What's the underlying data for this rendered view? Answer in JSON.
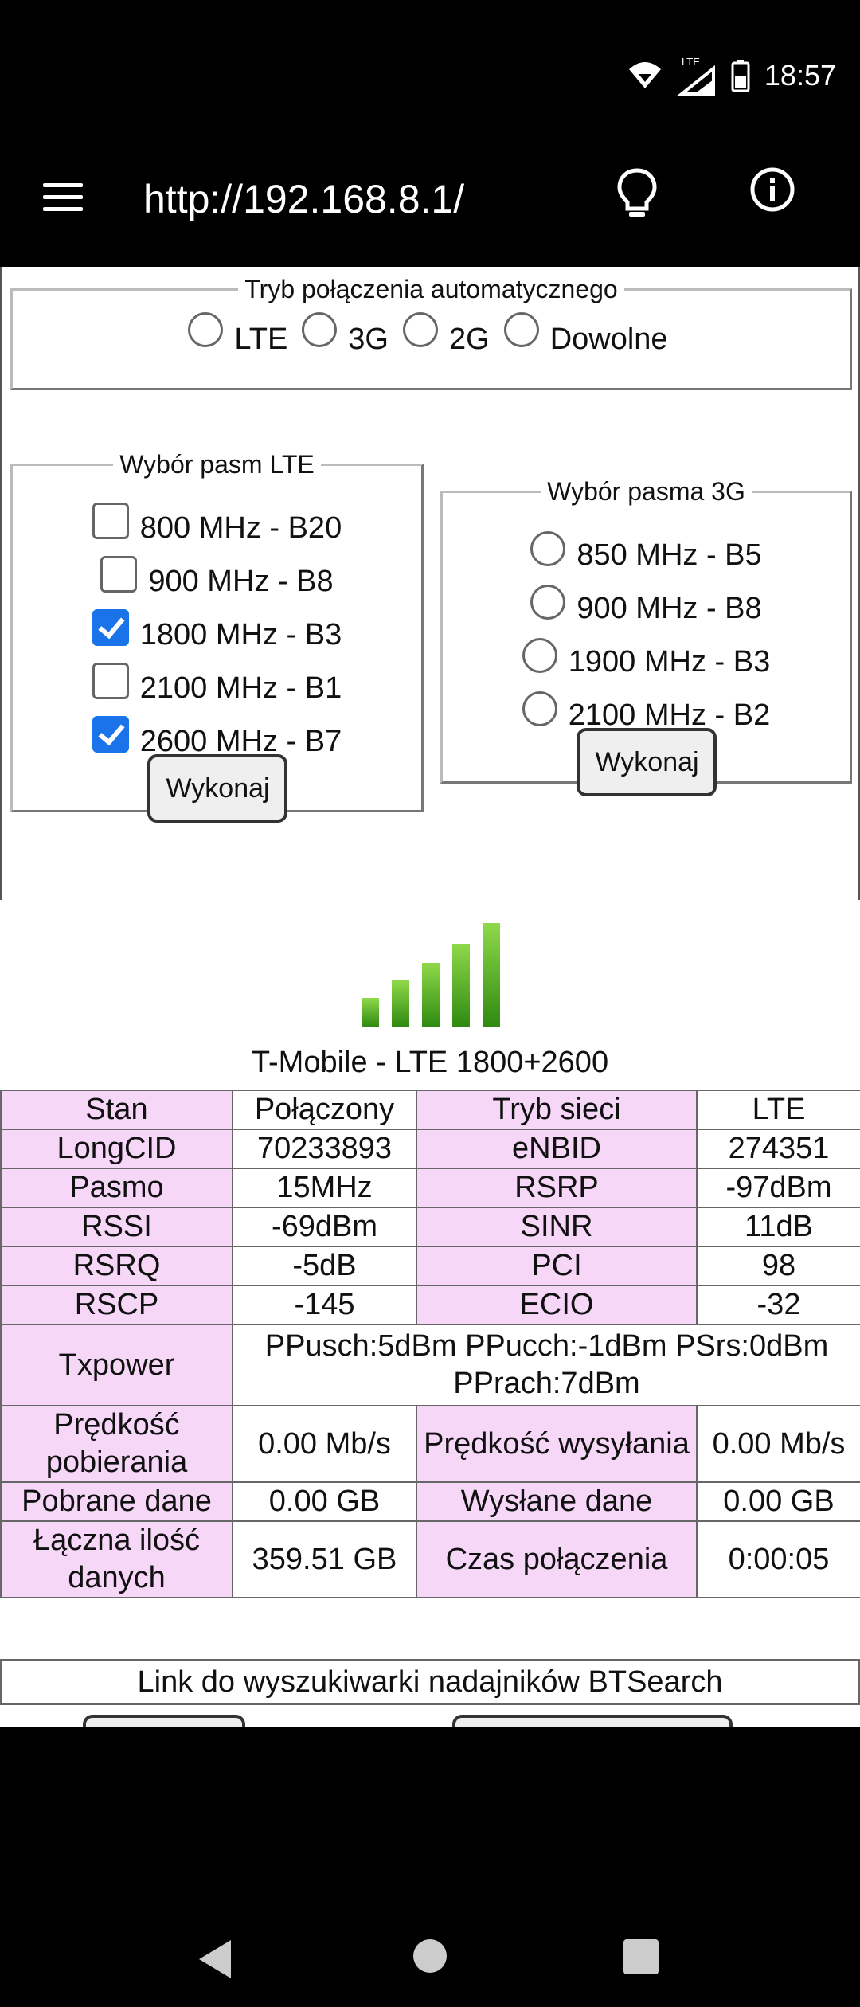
{
  "status_bar": {
    "time": "18:57",
    "network": "LTE"
  },
  "app_bar": {
    "url": "http://192.168.8.1/"
  },
  "connection_mode": {
    "legend": "Tryb połączenia automatycznego",
    "options": [
      "LTE",
      "3G",
      "2G",
      "Dowolne"
    ]
  },
  "lte_bands": {
    "legend": "Wybór pasm LTE",
    "items": [
      {
        "label": "800 MHz - B20",
        "checked": false
      },
      {
        "label": "900 MHz - B8",
        "checked": false
      },
      {
        "label": "1800 MHz - B3",
        "checked": true
      },
      {
        "label": "2100 MHz - B1",
        "checked": false
      },
      {
        "label": "2600 MHz - B7",
        "checked": true
      }
    ],
    "button": "Wykonaj"
  },
  "band_3g": {
    "legend": "Wybór pasma 3G",
    "items": [
      "850 MHz - B5",
      "900 MHz - B8",
      "1900 MHz - B3",
      "2100 MHz - B2"
    ],
    "button": "Wykonaj"
  },
  "signal": {
    "bars": 5,
    "active": 5,
    "color": "#3a9a1a"
  },
  "operator": "T-Mobile - LTE 1800+2600",
  "table": [
    [
      "Stan",
      "Połączony",
      "Tryb sieci",
      "LTE"
    ],
    [
      "LongCID",
      "70233893",
      "eNBID",
      "274351"
    ],
    [
      "Pasmo",
      "15MHz",
      "RSRP",
      "-97dBm"
    ],
    [
      "RSSI",
      "-69dBm",
      "SINR",
      "11dB"
    ],
    [
      "RSRQ",
      "-5dB",
      "PCI",
      "98"
    ],
    [
      "RSCP",
      "-145",
      "ECIO",
      "-32"
    ],
    [
      "Prędkość pobierania",
      "0.00 Mb/s",
      "Prędkość wysyłania",
      "0.00 Mb/s"
    ],
    [
      "Pobrane dane",
      "0.00 GB",
      "Wysłane dane",
      "0.00 GB"
    ],
    [
      "Łączna ilość danych",
      "359.51 GB",
      "Czas połączenia",
      "0:00:05"
    ]
  ],
  "txpower": {
    "label": "Txpower",
    "value": "PPusch:5dBm PPucch:-1dBm PSrs:0dBm PPrach:7dBm"
  },
  "btsearch_link": "Link do wyszukiwarki nadajników BTSearch"
}
